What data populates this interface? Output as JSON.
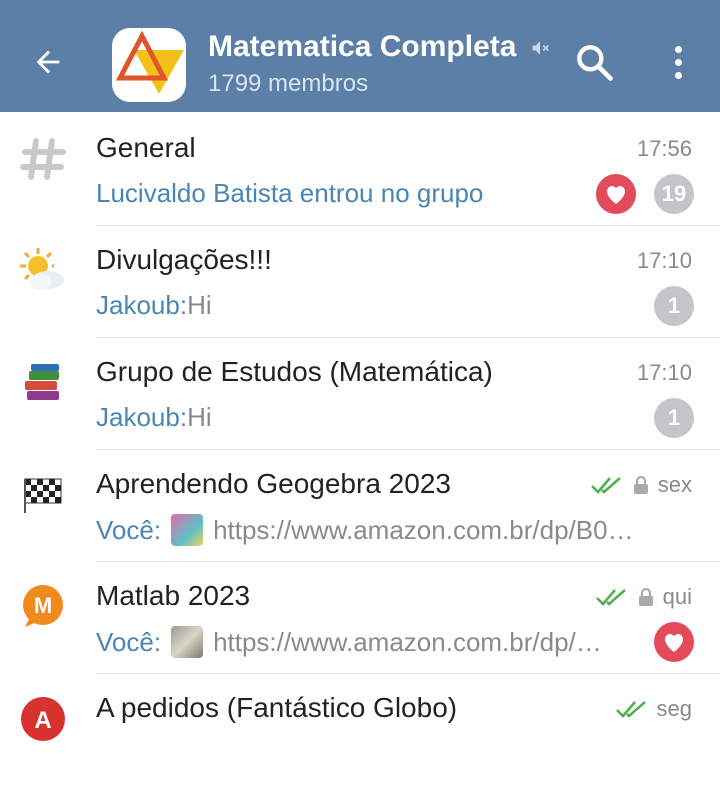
{
  "header": {
    "title": "Matematica Completa",
    "subtitle": "1799 membros",
    "bg_color": "#5b7fa6"
  },
  "chats": [
    {
      "icon": "hash-icon",
      "name": "General",
      "time": "17:56",
      "sender": "",
      "message": "Lucivaldo Batista entrou no grupo",
      "message_color": "#4a86b5",
      "reaction": "heart",
      "unread": "19"
    },
    {
      "icon": "sun-cloud-icon",
      "name": "Divulgações!!!",
      "time": "17:10",
      "sender": "Jakoub:",
      "message": " Hi",
      "unread": "1"
    },
    {
      "icon": "books-icon",
      "name": "Grupo de Estudos (Matemática)",
      "time": "17:10",
      "sender": "Jakoub:",
      "message": " Hi",
      "unread": "1"
    },
    {
      "icon": "checkered-flag-icon",
      "name": "Aprendendo Geogebra 2023",
      "time": "sex",
      "sender": "Você:",
      "message": "https://www.amazon.com.br/dp/B0…",
      "read_status": "double-check",
      "locked": true
    },
    {
      "icon": "m-bubble-icon",
      "name": "Matlab 2023",
      "time": "qui",
      "sender": "Você:",
      "message": "https://www.amazon.com.br/dp/…",
      "read_status": "double-check",
      "locked": true,
      "reaction": "heart"
    },
    {
      "icon": "a-circle-icon",
      "name": "A pedidos (Fantástico Globo)",
      "time": "seg",
      "read_status": "double-check"
    }
  ]
}
